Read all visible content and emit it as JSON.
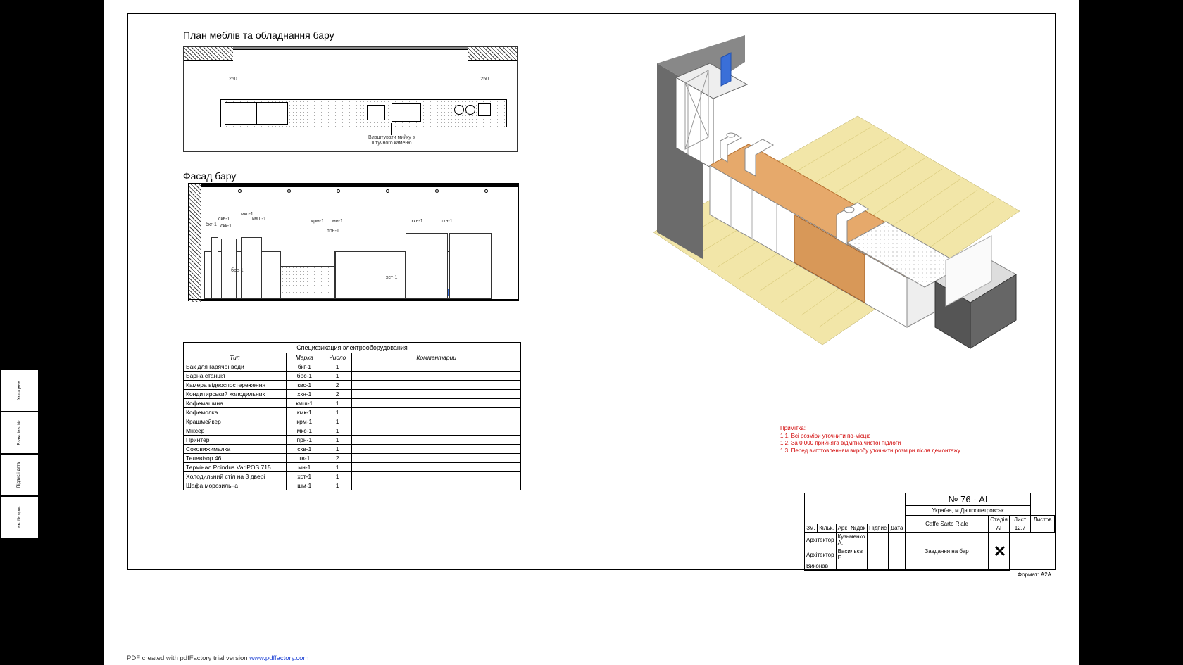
{
  "binding_labels": [
    "Інв. № ориг.",
    "Підпис і дата",
    "Взам. інв. №",
    "Уз годжен"
  ],
  "plan": {
    "title": "План меблів та обладнання бару",
    "note": "Влаштувати мийку з\nштучного каменю",
    "dims": [
      "250",
      "250"
    ]
  },
  "facade": {
    "title": "Фасад бару",
    "tags": [
      "бкг-1",
      "скв-1",
      "кжк-1",
      "кмш-1",
      "мкс-1",
      "крм-1",
      "мн-1",
      "прн-1",
      "хкн-1",
      "хкн-1",
      "брс-1",
      "хст-1"
    ]
  },
  "spec": {
    "caption": "Спецификация электрооборудования",
    "headers": [
      "Тип",
      "Марка",
      "Число",
      "Комментарии"
    ],
    "rows": [
      [
        "Бак для гарячої води",
        "бкг-1",
        "1",
        ""
      ],
      [
        "Барна станція",
        "брс-1",
        "1",
        ""
      ],
      [
        "Камера відеоспостереження",
        "квс-1",
        "2",
        ""
      ],
      [
        "Кондитирський холодильник",
        "хкн-1",
        "2",
        ""
      ],
      [
        "Кофемашина",
        "кмш-1",
        "1",
        ""
      ],
      [
        "Кофемолка",
        "кмк-1",
        "1",
        ""
      ],
      [
        "Крашмейкер",
        "крм-1",
        "1",
        ""
      ],
      [
        "Міксер",
        "мкс-1",
        "1",
        ""
      ],
      [
        "Принтер",
        "прн-1",
        "1",
        ""
      ],
      [
        "Соковижималка",
        "скв-1",
        "1",
        ""
      ],
      [
        "Телевізор 46",
        "тв-1",
        "2",
        ""
      ],
      [
        "Термінал Poindus VariPOS 715",
        "мн-1",
        "1",
        ""
      ],
      [
        "Холодильний стіл на 3 двері",
        "хст-1",
        "1",
        ""
      ],
      [
        "Шафа морозильна",
        "шм-1",
        "1",
        ""
      ]
    ]
  },
  "notes": {
    "heading": "Примітка:",
    "items": [
      "1.1. Всі розміри уточнити по-місцю",
      "1.2. За 0.000 прийнята відмітна чистої підлоги",
      "1.3. Перед виготовленням виробу уточнити розміри після демонтажу"
    ]
  },
  "titleblock": {
    "project_no": "№ 76 - АІ",
    "location": "Україна, м.Дніпропетровськ",
    "object": "Caffe Sarto Riale",
    "drawing": "Завдання на бар",
    "rev_headers": [
      "Зм.",
      "Кільк.",
      "Арк",
      "№док",
      "Підпис",
      "Дата"
    ],
    "roles": [
      [
        "Архітектор",
        "Кузьменко А.",
        ""
      ],
      [
        "Архітектор",
        "Васильєв Е.",
        ""
      ],
      [
        "Виконав",
        "",
        ""
      ]
    ],
    "cols": {
      "stage_h": "Стадія",
      "sheet_h": "Лист",
      "sheets_h": "Листов",
      "stage": "АІ",
      "sheet": "12.7",
      "sheets": ""
    },
    "format": "Формат: А2А"
  },
  "footer": {
    "text": "PDF created with pdfFactory trial version ",
    "url": "www.pdffactory.com"
  }
}
